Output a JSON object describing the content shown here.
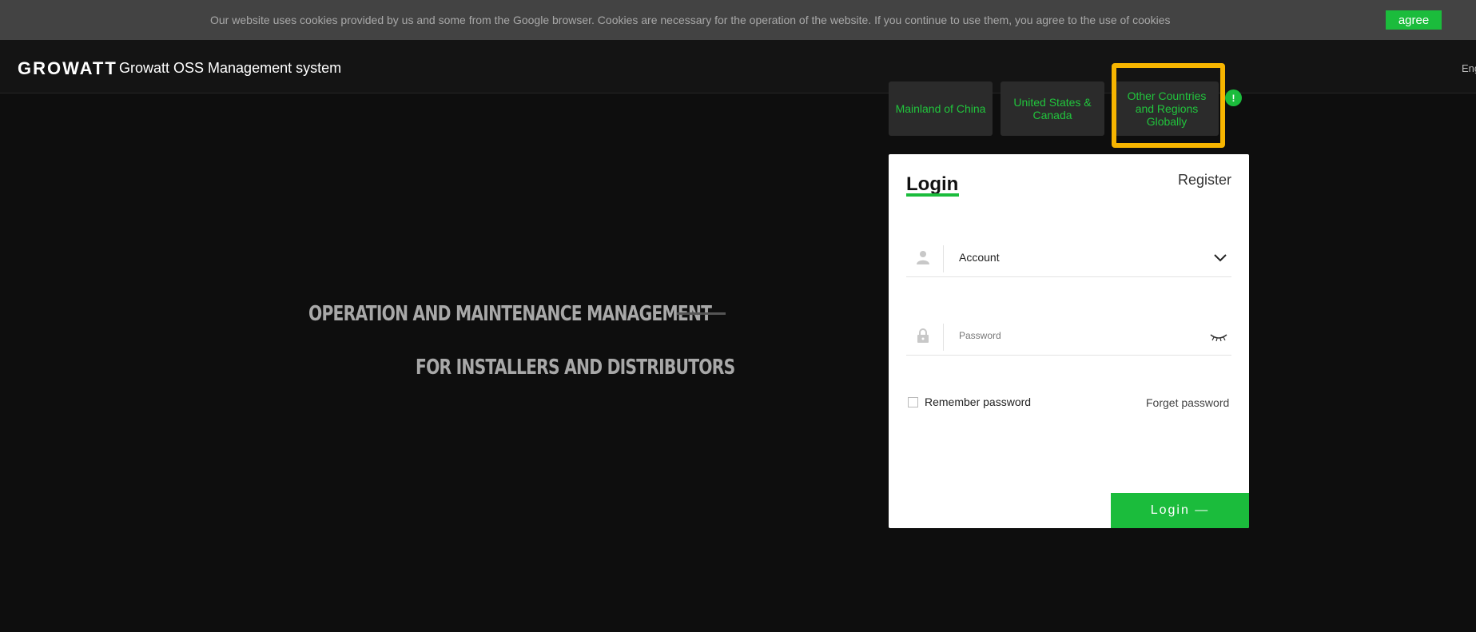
{
  "cookie": {
    "text": "Our website uses cookies provided by us and some from the Google browser. Cookies are necessary for the operation of the website. If you continue to use them, you agree to the use of cookies",
    "agree_label": "agree"
  },
  "header": {
    "logo": "GROWATT",
    "title": "Growatt OSS Management system",
    "language": "Eng"
  },
  "regions": [
    {
      "label": "Mainland of China"
    },
    {
      "label": "United States & Canada"
    },
    {
      "label": "Other Countries and Regions Globally",
      "highlighted": true
    }
  ],
  "info_badge": "!",
  "slogan": {
    "line1": "OPERATION AND MAINTENANCE MANAGEMENT",
    "line2": "FOR INSTALLERS AND DISTRIBUTORS"
  },
  "login": {
    "heading": "Login",
    "register_label": "Register",
    "account_value": "Account",
    "password_placeholder": "Password",
    "remember_label": "Remember password",
    "forget_label": "Forget password",
    "submit_label": "Login —"
  },
  "colors": {
    "accent": "#1bbc3c",
    "highlight": "#f7b500",
    "background": "#0e0e0e"
  }
}
